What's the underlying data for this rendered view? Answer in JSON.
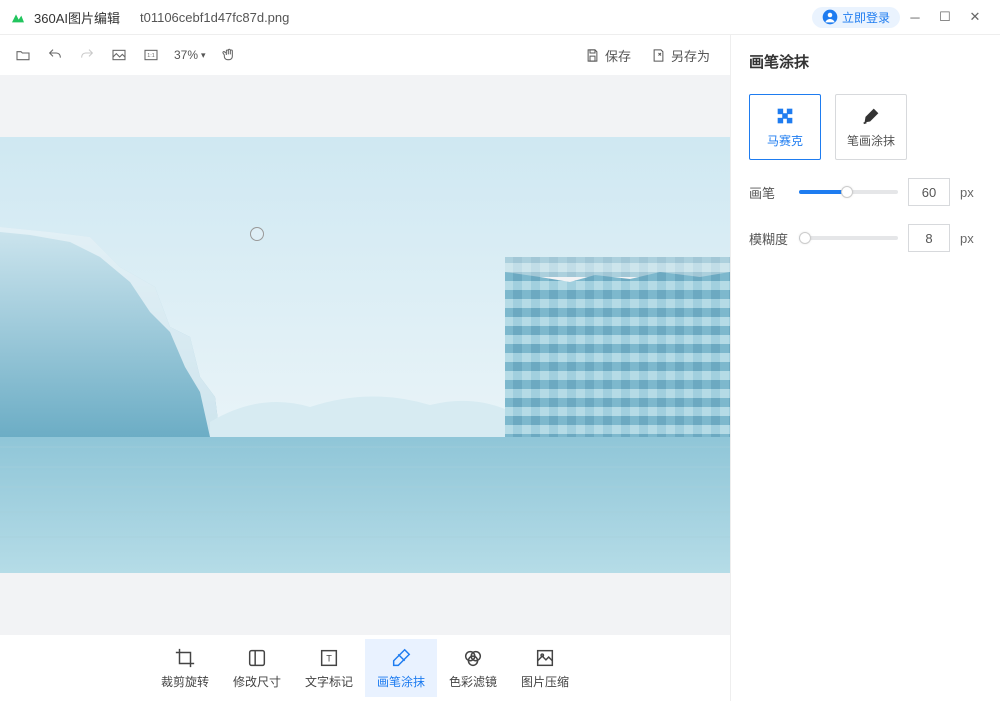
{
  "title": {
    "app_name": "360AI图片编辑",
    "file_name": "t01106cebf1d47fc87d.png"
  },
  "login_button": "立即登录",
  "toolbar": {
    "zoom": "37%",
    "save": "保存",
    "save_as": "另存为"
  },
  "right_panel": {
    "title": "画笔涂抹",
    "tool_mosaic": "马赛克",
    "tool_smear": "笔画涂抹",
    "brush_label": "画笔",
    "brush_value": "60",
    "brush_unit": "px",
    "blur_label": "模糊度",
    "blur_value": "8",
    "blur_unit": "px"
  },
  "bottom_tabs": {
    "crop": "裁剪旋转",
    "resize": "修改尺寸",
    "text": "文字标记",
    "brush": "画笔涂抹",
    "filter": "色彩滤镜",
    "compress": "图片压缩"
  }
}
